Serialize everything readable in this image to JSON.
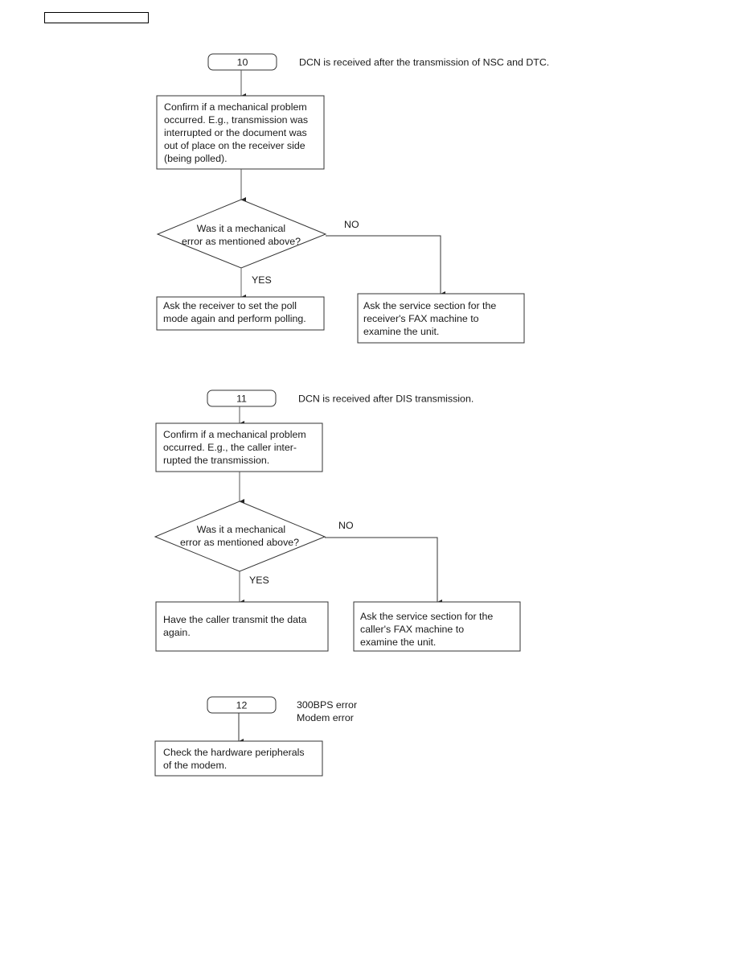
{
  "header": {
    "label": ""
  },
  "sections": [
    {
      "id": "10",
      "description": "DCN is received after the transmission of NSC and DTC.",
      "check_step": [
        "Confirm if a mechanical problem",
        "occurred. E.g., transmission was",
        "interrupted or the document was",
        "out of place on the receiver side",
        "(being polled)."
      ],
      "decision": [
        "Was it a mechanical",
        "error as mentioned above?"
      ],
      "yes_label": "YES",
      "no_label": "NO",
      "yes_action": [
        "Ask the receiver to set the poll",
        "mode again and perform polling."
      ],
      "no_action": [
        "Ask the service section for the",
        "receiver's FAX machine to",
        "examine the unit."
      ]
    },
    {
      "id": "11",
      "description": "DCN is received after DIS transmission.",
      "check_step": [
        "Confirm if a mechanical problem",
        "occurred. E.g., the caller inter-",
        "rupted the transmission."
      ],
      "decision": [
        "Was it a mechanical",
        "error as mentioned above?"
      ],
      "yes_label": "YES",
      "no_label": "NO",
      "yes_action": [
        "Have the caller transmit the data",
        "again."
      ],
      "no_action": [
        "Ask the service section for the",
        "caller's FAX machine to",
        "examine the unit."
      ]
    },
    {
      "id": "12",
      "description_lines": [
        "300BPS error",
        "Modem error"
      ],
      "check_step": [
        "Check the hardware peripherals",
        "of the modem."
      ]
    }
  ]
}
